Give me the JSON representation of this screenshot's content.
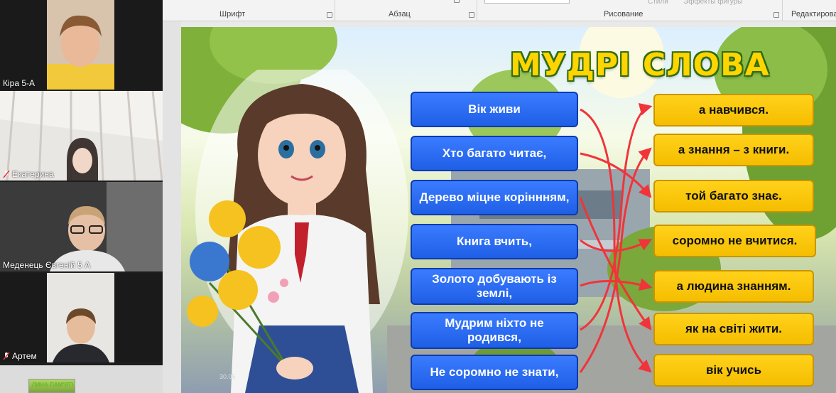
{
  "ribbon": {
    "groups": [
      {
        "label": "Шрифт"
      },
      {
        "label": "Абзац"
      },
      {
        "label": "Рисование"
      },
      {
        "label": "Редактирова"
      }
    ],
    "faded_styles": "Стили",
    "faded_effects": "Эффекты фигуры"
  },
  "participants": [
    {
      "name": "Кіра 5-А",
      "muted": false
    },
    {
      "name": "Екатерина",
      "muted": true
    },
    {
      "name": "Меденець Євгеній 5 А",
      "muted": false
    },
    {
      "name": "Артем",
      "muted": true
    }
  ],
  "thumbnail": {
    "text": "ЛИНА ПАМ'ЯТІ"
  },
  "slide": {
    "title": "МУДРІ СЛОВА",
    "left_phrases": [
      "Вік живи",
      "Хто багато читає,",
      "Дерево міцне коріннням,",
      "Книга вчить,",
      "Золото добувають із землі,",
      "Мудрим ніхто не родився,",
      "Не соромно не знати,"
    ],
    "right_phrases": [
      "а навчився.",
      "а знання – з книги.",
      "той багато знає.",
      "соромно не вчитися.",
      "а людина знанням.",
      "як на світі жити.",
      "вік учись"
    ],
    "watermark": "30.05",
    "arrow_color": "#f0343a",
    "blue_color": "#2467f2",
    "yellow_color": "#ffc60a",
    "title_color": "#ffd400"
  },
  "icons": {
    "mic_off": "mic-off-icon",
    "launcher": "dialog-launcher-icon"
  }
}
